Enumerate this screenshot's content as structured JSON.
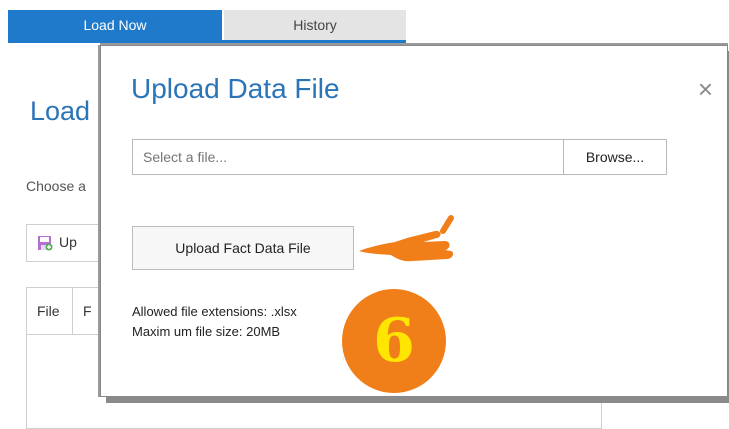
{
  "tabs": [
    {
      "label": "Load Now",
      "active": true
    },
    {
      "label": "History",
      "active": false
    }
  ],
  "background": {
    "title": "Load",
    "choose_text": "Choose a",
    "upload_button_label": "Up",
    "table_headers": [
      "File",
      "F"
    ]
  },
  "modal": {
    "title": "Upload Data File",
    "close_symbol": "×",
    "file_input": {
      "placeholder": "Select a file...",
      "value": ""
    },
    "browse_label": "Browse...",
    "upload_button_label": "Upload Fact Data File",
    "info_lines": [
      "Allowed file extensions: .xlsx",
      "Maxim um file size: 20MB"
    ]
  },
  "annotation": {
    "step_number": "6"
  },
  "colors": {
    "accent": "#1f7acb",
    "title": "#2a74b8",
    "badge": "#f07f1a",
    "badge_text": "#ffe600"
  }
}
